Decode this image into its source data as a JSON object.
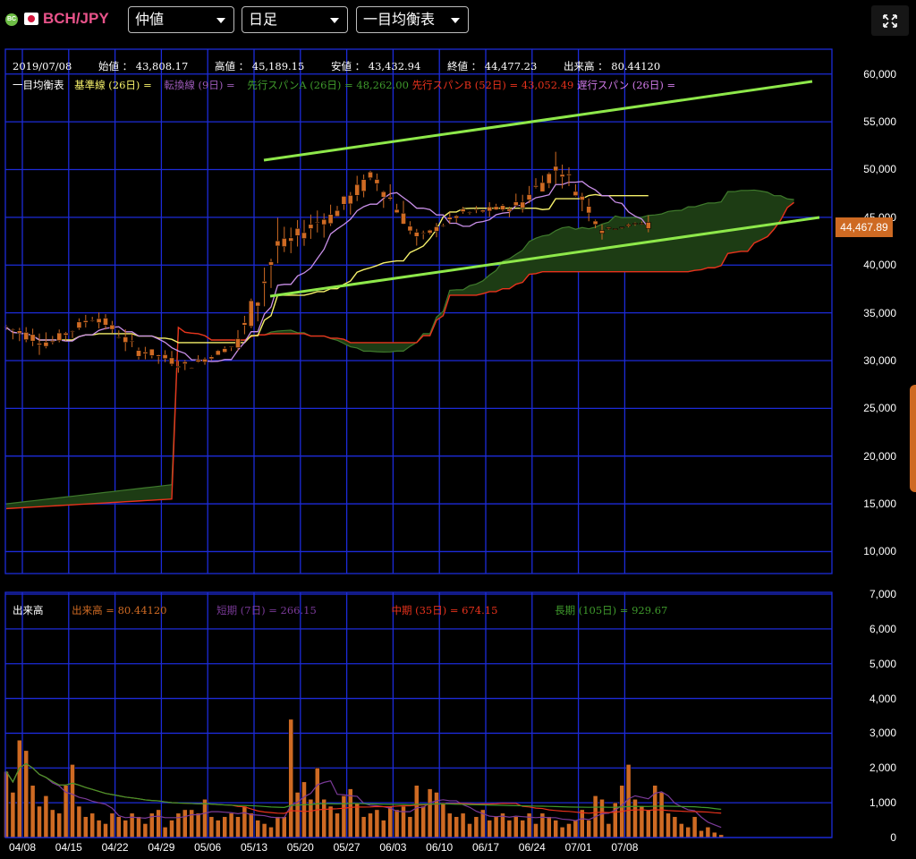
{
  "header": {
    "pair": "BCH/JPY",
    "price_type": "仲値",
    "period": "日足",
    "indicator": "一目均衡表",
    "coin_badge": "BC",
    "expand_icon": "expand-icon"
  },
  "info": {
    "date": "2019/07/08",
    "open_label": "始値 ：",
    "open": "43,808.17",
    "high_label": "高値 ：",
    "high": "45,189.15",
    "low_label": "安値 ：",
    "low": "43,432.94",
    "close_label": "終値 ：",
    "close": "44,477.23",
    "volume_label": "出来高 ：",
    "volume": "80.44120"
  },
  "ichimoku_legend": {
    "title": "一目均衡表",
    "kijun": "基準線 (26日) =",
    "tenkan": "転換線 (9日) =",
    "spanA": "先行スパンA (26日) =",
    "spanA_value": "48,262.00",
    "spanB": "先行スパンB (52日) =",
    "spanB_value": "43,052.49",
    "chikou": "遅行スパン (26日) ="
  },
  "volume_legend": {
    "title": "出来高",
    "vol": "出来高 =",
    "vol_value": "80.44120",
    "short": "短期 (7日) =",
    "short_value": "266.15",
    "mid": "中期 (35日) =",
    "mid_value": "674.15",
    "long": "長期 (105日) =",
    "long_value": "929.67"
  },
  "last_price": "44,467.89",
  "colors": {
    "grid": "#1c2bd8",
    "candle": "#ce6a23",
    "kijun": "#f5f06a",
    "tenkan": "#c98fe8",
    "spanA": "#3f7a2c",
    "spanB": "#e8321c",
    "cloud": "#1d3c14",
    "trendline": "#8ee84a",
    "volume_bar": "#ce6a23"
  },
  "chart_data": [
    {
      "type": "candlestick",
      "title": "BCH/JPY",
      "x_tick_labels": [
        "04/08",
        "04/15",
        "04/22",
        "04/29",
        "05/06",
        "05/13",
        "05/20",
        "05/27",
        "06/03",
        "06/10",
        "06/17",
        "06/24",
        "07/01",
        "07/08"
      ],
      "y_tick_labels": [
        "60,000",
        "55,000",
        "50,000",
        "45,000",
        "40,000",
        "35,000",
        "30,000",
        "25,000",
        "20,000",
        "15,000",
        "10,000"
      ],
      "ylim": [
        7700,
        62600
      ],
      "ohlc_weekly": [
        {
          "week": "04/08",
          "open": 33500,
          "high": 37000,
          "low": 29500,
          "close": 32000
        },
        {
          "week": "04/15",
          "open": 32000,
          "high": 36000,
          "low": 30500,
          "close": 34500
        },
        {
          "week": "04/22",
          "open": 34500,
          "high": 35500,
          "low": 29000,
          "close": 31000
        },
        {
          "week": "04/29",
          "open": 31000,
          "high": 32000,
          "low": 26500,
          "close": 29500
        },
        {
          "week": "05/06",
          "open": 29500,
          "high": 33000,
          "low": 29000,
          "close": 31500
        },
        {
          "week": "05/13",
          "open": 31500,
          "high": 49500,
          "low": 31000,
          "close": 42000
        },
        {
          "week": "05/20",
          "open": 42000,
          "high": 49000,
          "low": 39500,
          "close": 45000
        },
        {
          "week": "05/27",
          "open": 45000,
          "high": 53500,
          "low": 43000,
          "close": 49000
        },
        {
          "week": "06/03",
          "open": 49000,
          "high": 52000,
          "low": 41500,
          "close": 43000
        },
        {
          "week": "06/10",
          "open": 43000,
          "high": 46500,
          "low": 42000,
          "close": 45500
        },
        {
          "week": "06/17",
          "open": 45500,
          "high": 48500,
          "low": 44000,
          "close": 46000
        },
        {
          "week": "06/24",
          "open": 46000,
          "high": 56000,
          "low": 45000,
          "close": 50000
        },
        {
          "week": "07/01",
          "open": 50000,
          "high": 51000,
          "low": 42500,
          "close": 44000
        },
        {
          "week": "07/08",
          "open": 43808.17,
          "high": 45189.15,
          "low": 43432.94,
          "close": 44477.23
        }
      ],
      "last_price": 44467.89
    },
    {
      "type": "bar",
      "title": "出来高",
      "y_tick_labels": [
        "7,000",
        "6,000",
        "5,000",
        "4,000",
        "3,000",
        "2,000",
        "1,000",
        "0"
      ],
      "ylim": [
        0,
        7000
      ],
      "x_tick_labels": [
        "04/08",
        "04/15",
        "04/22",
        "04/29",
        "05/06",
        "05/13",
        "05/20",
        "05/27",
        "06/03",
        "06/10",
        "06/17",
        "06/24",
        "07/01",
        "07/08"
      ],
      "values": [
        1900,
        1300,
        2800,
        2500,
        1500,
        900,
        1200,
        800,
        700,
        1500,
        2100,
        900,
        600,
        700,
        500,
        400,
        700,
        600,
        500,
        700,
        600,
        400,
        700,
        800,
        300,
        500,
        700,
        800,
        800,
        700,
        1100,
        600,
        500,
        600,
        700,
        600,
        900,
        700,
        500,
        400,
        300,
        600,
        600,
        3400,
        1300,
        1600,
        1100,
        2000,
        1100,
        900,
        700,
        1200,
        1400,
        1000,
        600,
        700,
        800,
        500,
        900,
        800,
        900,
        600,
        1500,
        900,
        1400,
        1300,
        1000,
        700,
        600,
        700,
        400,
        600,
        800,
        500,
        600,
        700,
        500,
        600,
        500,
        700,
        400,
        700,
        600,
        500,
        300,
        400,
        500,
        800,
        500,
        1200,
        1100,
        400,
        1000,
        1500,
        2100,
        1100,
        900,
        800,
        1500,
        1300,
        700,
        600,
        400,
        300,
        600,
        200,
        300,
        150,
        80
      ],
      "series": [
        {
          "name": "短期 (7日)",
          "last": 266.15
        },
        {
          "name": "中期 (35日)",
          "last": 674.15
        },
        {
          "name": "長期 (105日)",
          "last": 929.67
        }
      ]
    }
  ]
}
